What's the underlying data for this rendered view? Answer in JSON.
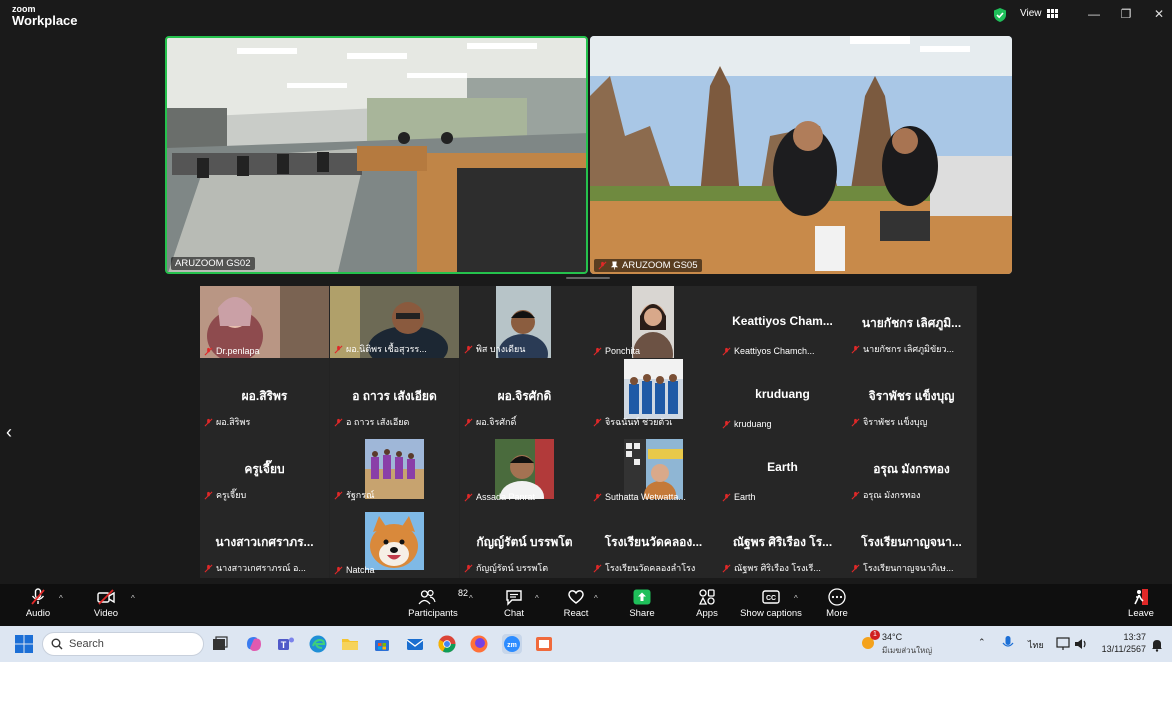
{
  "app": {
    "brand_top": "zoom",
    "brand_bottom": "Workplace",
    "view_label": "View"
  },
  "top_videos": [
    {
      "label": "ARUZOOM GS02"
    },
    {
      "label": "ARUZOOM GS05"
    }
  ],
  "gallery": [
    {
      "name": "",
      "label": "Dr.penlapa"
    },
    {
      "name": "",
      "label": "ผอ.นิติพร เชื้อสุวรร..."
    },
    {
      "name": "",
      "label": "พิส บางเดียน"
    },
    {
      "name": "",
      "label": "Ponchita"
    },
    {
      "name": "Keattiyos Cham...",
      "label": "Keattiyos Chamch..."
    },
    {
      "name": "นายกัชกร เลิศภูมิ...",
      "label": "นายกัชกร เลิศภูมิขัยว..."
    },
    {
      "name": "ผอ.สิริพร",
      "label": "ผอ.สิริพร"
    },
    {
      "name": "อ ถาวร เสังเอียด",
      "label": "อ ถาวร เสังเอียด"
    },
    {
      "name": "ผอ.จิรศักดิ",
      "label": "ผอ.จิรศักดิ์"
    },
    {
      "name": "",
      "label": "จิรฉนันท์ ช่วยตัวเ"
    },
    {
      "name": "kruduang",
      "label": "kruduang"
    },
    {
      "name": "จิราพัชร แข็งบุญ",
      "label": "จิราพัชร แข็งบุญ"
    },
    {
      "name": "ครูเจี๊ยบ",
      "label": "ครูเจี๊ยบ"
    },
    {
      "name": "",
      "label": "รัฐกรณ์"
    },
    {
      "name": "",
      "label": "Assada Panrat"
    },
    {
      "name": "",
      "label": "Suthatta Wetwatta..."
    },
    {
      "name": "Earth",
      "label": "Earth"
    },
    {
      "name": "อรุณ มังกรทอง",
      "label": "อรุณ มังกรทอง"
    },
    {
      "name": "นางสาวเกศราภร...",
      "label": "นางสาวเกศราภรณ์ อ..."
    },
    {
      "name": "",
      "label": "Natcha"
    },
    {
      "name": "กัญญ์รัตน์ บรรพโต",
      "label": "กัญญ์รัตน์ บรรพโต"
    },
    {
      "name": "โรงเรียนวัดคลอง...",
      "label": "โรงเรียนวัดคลองลำโรง"
    },
    {
      "name": "ณัฐพร ศิริเรือง โร...",
      "label": "ณัฐพร ศิริเรือง โรงเรี..."
    },
    {
      "name": "โรงเรียนกาญจนา...",
      "label": "โรงเรียนกาญจนาภิเษ..."
    }
  ],
  "toolbar": {
    "audio": "Audio",
    "video": "Video",
    "participants": "Participants",
    "participants_count": "82",
    "chat": "Chat",
    "react": "React",
    "share": "Share",
    "apps": "Apps",
    "captions": "Show captions",
    "more": "More",
    "leave": "Leave"
  },
  "taskbar": {
    "search_placeholder": "Search",
    "weather_temp": "34°C",
    "weather_desc": "มีเมฆส่วนใหญ่",
    "weather_badge": "1",
    "lang": "ไทย",
    "time": "13:37",
    "date": "13/11/2567"
  },
  "colors": {
    "active_speaker": "#25c24d",
    "share_green": "#1fbf5a",
    "muted_red": "#e02828",
    "leave_red": "#e02828"
  }
}
